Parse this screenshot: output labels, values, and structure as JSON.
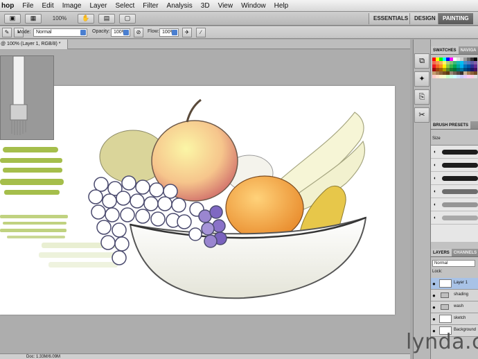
{
  "menubar": {
    "app": "hop",
    "items": [
      "File",
      "Edit",
      "Image",
      "Layer",
      "Select",
      "Filter",
      "Analysis",
      "3D",
      "View",
      "Window",
      "Help"
    ]
  },
  "appbar": {
    "zoom": "100%",
    "workspaces": [
      "ESSENTIALS",
      "DESIGN",
      "PAINTING"
    ]
  },
  "options": {
    "mode_label": "Mode:",
    "mode_value": "Normal",
    "opacity_label": "Opacity:",
    "opacity_value": "100%",
    "flow_label": "Flow:",
    "flow_value": "100%"
  },
  "document": {
    "tab_title": "@ 100% (Layer 1, RGB/8) *",
    "status": "Doc: 1.33M/6.09M"
  },
  "panels": {
    "swatches_tabs": [
      "SWATCHES",
      "NAVIGA"
    ],
    "brush_tab": "BRUSH PRESETS",
    "brush_size_label": "Size",
    "layers_tabs": [
      "LAYERS",
      "CHANNELS"
    ],
    "layers_blend": "Normal",
    "layers_lock": "Lock:",
    "layer_names": [
      "Layer 1",
      "shading",
      "wash",
      "sketch",
      "Background"
    ]
  },
  "watermark": "lynda.c",
  "colors": {
    "swatches": [
      "#ff0000",
      "#ffff00",
      "#00ff00",
      "#00ffff",
      "#0000ff",
      "#ff00ff",
      "#ffffff",
      "#e6e6e6",
      "#cccccc",
      "#999999",
      "#666666",
      "#333333",
      "#000000",
      "#f26c4f",
      "#f68e55",
      "#fbaf5c",
      "#fff467",
      "#acd372",
      "#7cc576",
      "#3bb878",
      "#1abbb4",
      "#00bff3",
      "#438ccb",
      "#5574b9",
      "#605ca8",
      "#855fa8",
      "#ed1c24",
      "#f26522",
      "#f7941d",
      "#fff200",
      "#8dc63f",
      "#39b54a",
      "#00a651",
      "#00a99d",
      "#00aeef",
      "#0072bc",
      "#0054a6",
      "#2e3192",
      "#662d91",
      "#9e0b0f",
      "#a0410d",
      "#a36209",
      "#aba000",
      "#598527",
      "#1a7b30",
      "#007236",
      "#00746b",
      "#0076a3",
      "#004b80",
      "#003471",
      "#1b1464",
      "#440e62",
      "#c69c6d",
      "#a67c52",
      "#8c6239",
      "#754c24",
      "#603913",
      "#998675",
      "#736357",
      "#534741",
      "#362f2d",
      "#c7b299",
      "#a67c52",
      "#8c6239",
      "#754c24",
      "#ffcccc",
      "#ffe0cc",
      "#fff2cc",
      "#f2ffcc",
      "#ccffcc",
      "#ccffe6",
      "#ccffff",
      "#cce5ff",
      "#ccccff",
      "#e6ccff",
      "#ffccf2",
      "#ffcce0",
      "#e0e0e0"
    ]
  }
}
